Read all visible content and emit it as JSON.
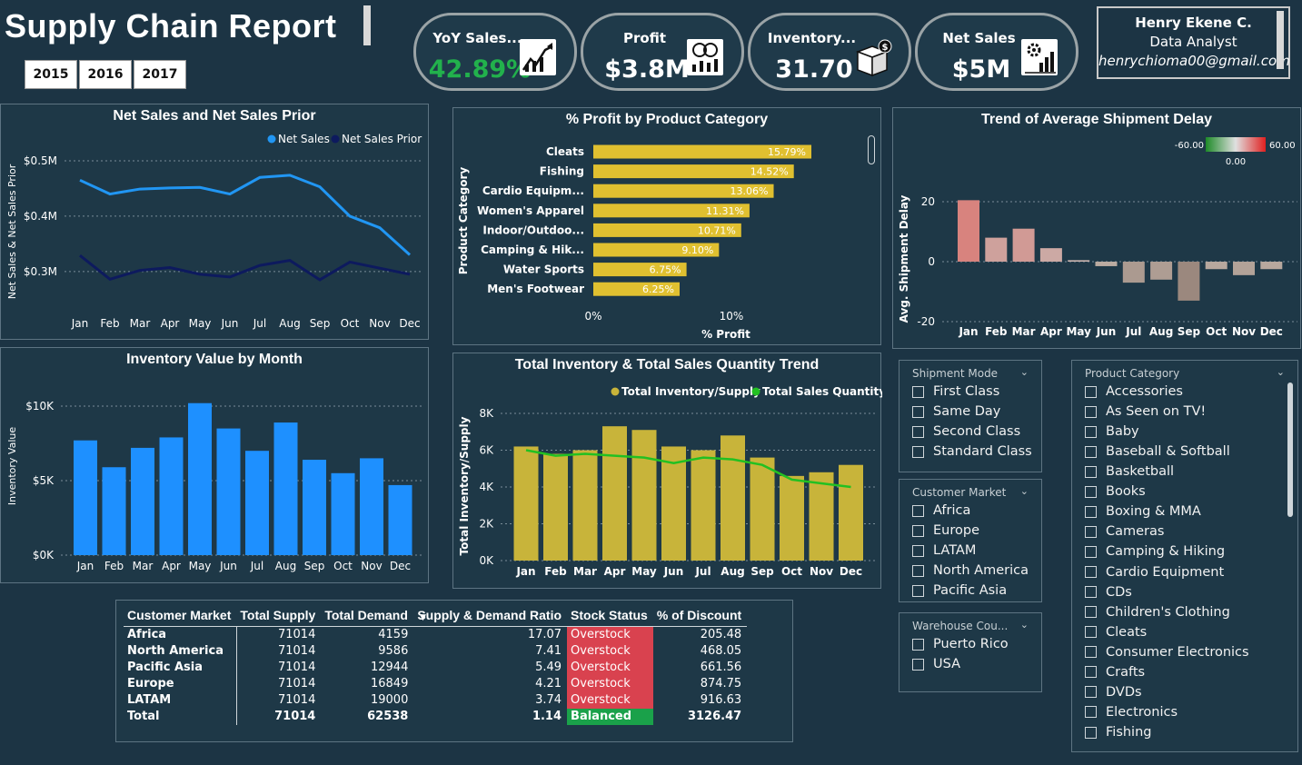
{
  "header": {
    "title": "Supply Chain Report",
    "years": [
      "2015",
      "2016",
      "2017"
    ]
  },
  "kpis": [
    {
      "label": "YoY Sales...",
      "value": "42.89%",
      "color": "#22b14c",
      "icon": "sales-growth-chart-icon"
    },
    {
      "label": "Profit",
      "value": "$3.8M",
      "color": "#ffffff",
      "icon": "profit-money-chart-icon"
    },
    {
      "label": "Inventory...",
      "value": "31.70",
      "color": "#ffffff",
      "icon": "inventory-box-dollar-icon"
    },
    {
      "label": "Net Sales",
      "value": "$5M",
      "color": "#ffffff",
      "icon": "net-sales-gear-chart-icon"
    }
  ],
  "profile": {
    "name": "Henry Ekene C.",
    "role": "Data Analyst",
    "email": "henrychioma00@gmail.com"
  },
  "chart_data": [
    {
      "id": "net-sales",
      "type": "line",
      "title": "Net Sales and Net Sales Prior",
      "ylabel": "Net Sales & Net Sales Prior",
      "categories": [
        "Jan",
        "Feb",
        "Mar",
        "Apr",
        "May",
        "Jun",
        "Jul",
        "Aug",
        "Sep",
        "Oct",
        "Nov",
        "Dec"
      ],
      "yticks": [
        "$0.3M",
        "$0.4M",
        "$0.5M"
      ],
      "ylim": [
        0.28,
        0.5
      ],
      "legend": "top-right",
      "series": [
        {
          "name": "Net Sales",
          "color": "#2196f3",
          "values": [
            0.465,
            0.44,
            0.449,
            0.451,
            0.452,
            0.44,
            0.47,
            0.474,
            0.453,
            0.4,
            0.379,
            0.33
          ]
        },
        {
          "name": "Net Sales Prior",
          "color": "#0d1a5e",
          "values": [
            0.329,
            0.286,
            0.302,
            0.307,
            0.295,
            0.29,
            0.311,
            0.32,
            0.285,
            0.317,
            0.306,
            0.295
          ]
        }
      ]
    },
    {
      "id": "profit-category",
      "type": "bar",
      "title": "% Profit by Product Category",
      "ylabel": "Product Category",
      "xlabel": "% Profit",
      "xticks": [
        "0%",
        "10%"
      ],
      "xlim": [
        0,
        20
      ],
      "color": "#e0c030",
      "categories": [
        "Cleats",
        "Fishing",
        "Cardio Equipm...",
        "Women's Apparel",
        "Indoor/Outdoo...",
        "Camping & Hik...",
        "Water Sports",
        "Men's Footwear"
      ],
      "values": [
        15.79,
        14.52,
        13.06,
        11.31,
        10.71,
        9.1,
        6.75,
        6.25
      ],
      "labels": [
        "15.79%",
        "14.52%",
        "13.06%",
        "11.31%",
        "10.71%",
        "9.10%",
        "6.75%",
        "6.25%"
      ]
    },
    {
      "id": "shipment-delay",
      "type": "bar",
      "title": "Trend of Average Shipment Delay",
      "ylabel": "Avg. Shipment Delay",
      "categories": [
        "Jan",
        "Feb",
        "Mar",
        "Apr",
        "May",
        "Jun",
        "Jul",
        "Aug",
        "Sep",
        "Oct",
        "Nov",
        "Dec"
      ],
      "yticks": [
        "-20",
        "0",
        "20"
      ],
      "ylim": [
        -20,
        22
      ],
      "values": [
        20.5,
        8,
        11,
        4.5,
        0.5,
        -1.5,
        -7,
        -6,
        -13,
        -2.5,
        -4.5,
        -2.5
      ],
      "legend": {
        "min": "-60.00",
        "mid": "0.00",
        "max": "60.00"
      }
    },
    {
      "id": "inventory-month",
      "type": "bar",
      "title": "Inventory Value by Month",
      "ylabel": "Inventory Value",
      "color": "#1e90ff",
      "categories": [
        "Jan",
        "Feb",
        "Mar",
        "Apr",
        "May",
        "Jun",
        "Jul",
        "Aug",
        "Sep",
        "Oct",
        "Nov",
        "Dec"
      ],
      "yticks": [
        "$0K",
        "$5K",
        "$10K"
      ],
      "ylim": [
        0,
        10000
      ],
      "values": [
        7700,
        5900,
        7200,
        7900,
        10200,
        8500,
        7000,
        8900,
        6400,
        5500,
        6500,
        4700
      ]
    },
    {
      "id": "inventory-sales-trend",
      "type": "bar",
      "title": "Total Inventory & Total Sales Quantity Trend",
      "ylabel": "Total Inventory/Supply",
      "legend": "top-right",
      "categories": [
        "Jan",
        "Feb",
        "Mar",
        "Apr",
        "May",
        "Jun",
        "Jul",
        "Aug",
        "Sep",
        "Oct",
        "Nov",
        "Dec"
      ],
      "yticks": [
        "0K",
        "2K",
        "4K",
        "6K",
        "8K"
      ],
      "ylim": [
        0,
        8000
      ],
      "series": [
        {
          "name": "Total Inventory/Supply",
          "color": "#c8b43a",
          "type": "bar",
          "values": [
            6200,
            5800,
            6000,
            7300,
            7100,
            6200,
            6000,
            6800,
            5600,
            4600,
            4800,
            5200
          ]
        },
        {
          "name": "Total Sales Quantity",
          "color": "#22c022",
          "type": "line",
          "values": [
            6000,
            5700,
            5800,
            5700,
            5600,
            5300,
            5600,
            5500,
            5200,
            4400,
            4200,
            4000
          ]
        }
      ]
    }
  ],
  "slicers": {
    "shipment": {
      "title": "Shipment Mode",
      "items": [
        "First Class",
        "Same Day",
        "Second Class",
        "Standard Class"
      ]
    },
    "market": {
      "title": "Customer Market",
      "items": [
        "Africa",
        "Europe",
        "LATAM",
        "North America",
        "Pacific Asia"
      ]
    },
    "warehouse": {
      "title": "Warehouse Cou...",
      "items": [
        "Puerto Rico",
        "USA"
      ]
    },
    "category": {
      "title": "Product Category",
      "items": [
        "Accessories",
        "As Seen on TV!",
        "Baby",
        "Baseball & Softball",
        "Basketball",
        "Books",
        "Boxing & MMA",
        "Cameras",
        "Camping & Hiking",
        "Cardio Equipment",
        "CDs",
        "Children's Clothing",
        "Cleats",
        "Consumer Electronics",
        "Crafts",
        "DVDs",
        "Electronics",
        "Fishing"
      ]
    }
  },
  "table": {
    "headers": [
      "Customer Market",
      "Total Supply",
      "Total Demand",
      "Supply & Demand Ratio",
      "Stock Status",
      "% of Discount"
    ],
    "overstock_color": "#d9424f",
    "balanced_color": "#1aa14a",
    "rows": [
      {
        "market": "Africa",
        "supply": "71014",
        "demand": "4159",
        "ratio": "17.07",
        "status": "Overstock",
        "discount": "205.48"
      },
      {
        "market": "North America",
        "supply": "71014",
        "demand": "9586",
        "ratio": "7.41",
        "status": "Overstock",
        "discount": "468.05"
      },
      {
        "market": "Pacific Asia",
        "supply": "71014",
        "demand": "12944",
        "ratio": "5.49",
        "status": "Overstock",
        "discount": "661.56"
      },
      {
        "market": "Europe",
        "supply": "71014",
        "demand": "16849",
        "ratio": "4.21",
        "status": "Overstock",
        "discount": "874.75"
      },
      {
        "market": "LATAM",
        "supply": "71014",
        "demand": "19000",
        "ratio": "3.74",
        "status": "Overstock",
        "discount": "916.63"
      }
    ],
    "total": {
      "market": "Total",
      "supply": "71014",
      "demand": "62538",
      "ratio": "1.14",
      "status": "Balanced",
      "discount": "3126.47"
    }
  }
}
